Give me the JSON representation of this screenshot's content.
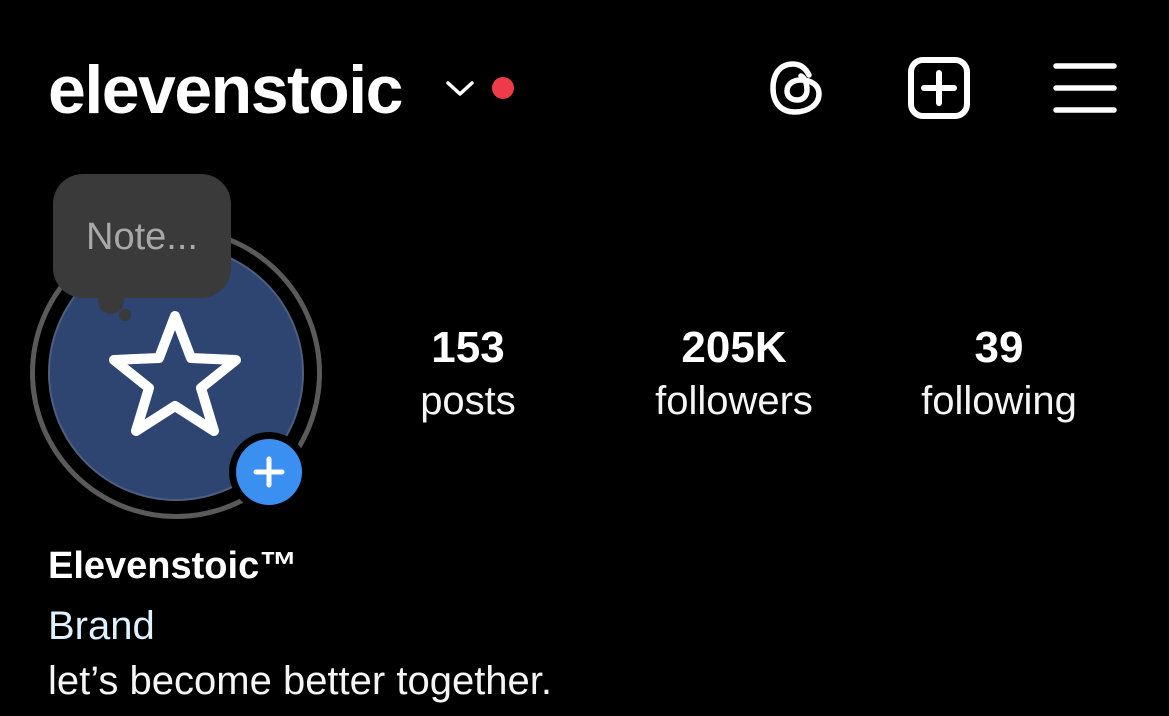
{
  "header": {
    "username": "elevenstoic",
    "icons": [
      "chevron-down-icon",
      "threads-icon",
      "plus-square-icon",
      "hamburger-menu-icon"
    ]
  },
  "note": {
    "placeholder": "Note..."
  },
  "stats": {
    "posts": {
      "value": "153",
      "label": "posts"
    },
    "followers": {
      "value": "205K",
      "label": "followers"
    },
    "following": {
      "value": "39",
      "label": "following"
    }
  },
  "profile": {
    "display_name": "Elevenstoic™",
    "category": "Brand",
    "bio": "let’s become better together."
  },
  "colors": {
    "background": "#000000",
    "text": "#ffffff",
    "notification_dot": "#ed3b4a",
    "avatar_fill": "#2d4570",
    "add_story_blue": "#3a8ff0",
    "category_link": "#e0f1ff"
  }
}
